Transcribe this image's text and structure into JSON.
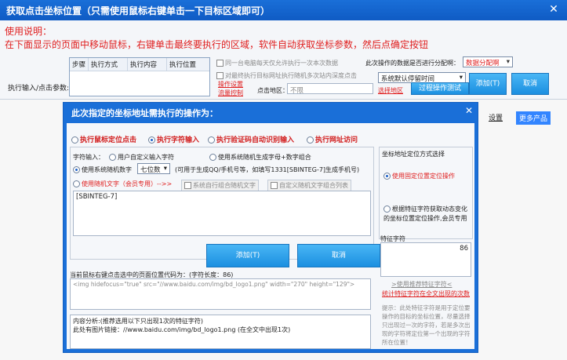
{
  "window": {
    "title": "获取点击坐标位置（只需使用鼠标右键单击一下目标区域即可）",
    "close": "✕"
  },
  "instructions": {
    "line1": "使用说明：",
    "line2": "在下面显示的页面中移动鼠标，右键单击最终要执行的区域，软件自动获取坐标参数，然后点确定按钮"
  },
  "exec_table": {
    "label": "执行输入/点击参数:",
    "columns": [
      "步骤",
      "执行方式",
      "执行内容",
      "执行位置"
    ]
  },
  "options": {
    "same_pc_once": "同一台电脑每天仅允许执行一次本次数据",
    "random_click": "对最终执行目标网址执行随机多次站内深度点击",
    "assign_label": "此次操作的数据是否进行分配啊：",
    "assign_value": "数据分配啊",
    "op_settings": "操作设置",
    "flow_control": "流量控制",
    "click_area_label": "点击地区：",
    "click_area_value": "不限",
    "wait_select": "系统默认停留时间",
    "select_area": "选择地区",
    "process_test": "过程操作测试",
    "add_btn": "添加(T)",
    "cancel_btn": "取消"
  },
  "bg_links": {
    "settings": "设置",
    "more_products": "更多产品"
  },
  "dialog": {
    "title": "此次指定的坐标地址需执行的操作为：",
    "close": "✕",
    "modes": [
      "执行鼠标定位点击",
      "执行字符输入",
      "执行验证码自动识别输入",
      "执行网址访问"
    ],
    "char_input_label": "字符输入：",
    "user_custom": "用户自定义输入字符",
    "sys_random_digits_letters": "使用系统随机生成字母+数字组合",
    "sys_random_number": "使用系统随机数字",
    "digits_select": "七位数",
    "digits_hint": "(可用于生成QQ/手机号等，如填写1331[SBINTEG-7]生成手机号)",
    "random_text_vip": "使用随机文字（会员专用）-->>",
    "sys_random_text": "系统自行组合随机文字",
    "custom_text_list": "自定义随机文字组合列表",
    "textarea_value": "[SBINTEG-7]",
    "add_btn": "添加(T)",
    "cancel_btn": "取消",
    "code_label": "当前鼠标右键点击选中的页面位置代码为：(字符长度：86)",
    "code_value": "<img hidefocus=\"true\" src=\"//www.baidu.com/img/bd_logo1.png\" width=\"270\" height=\"129\">",
    "analysis_line1": "内容分析:(推荐选用以下只出现1次的特征字符)",
    "analysis_line2": "此处有图片链接：//www.baidu.com/img/bd_logo1.png (在全文中出现1次)",
    "right_group_title": "坐标地址定位方式选择",
    "fixed_pos": "使用固定位置定位操作",
    "feature_pos": "根据特征字符获取动态变化的坐标位置定位操作,会员专用",
    "feature_label": "特征字符",
    "feature_count": "86",
    "use_recommended": ">使用推荐特征字符<",
    "count_occurrence": "统计特征字符在全文出现的次数",
    "tip": "提示：此处特征字符是用于定位要操作的目标的坐标位置，尽量选择只出现过一次的字符，若是多次出现的字符将定位第一个出现的字符所在位置！"
  }
}
